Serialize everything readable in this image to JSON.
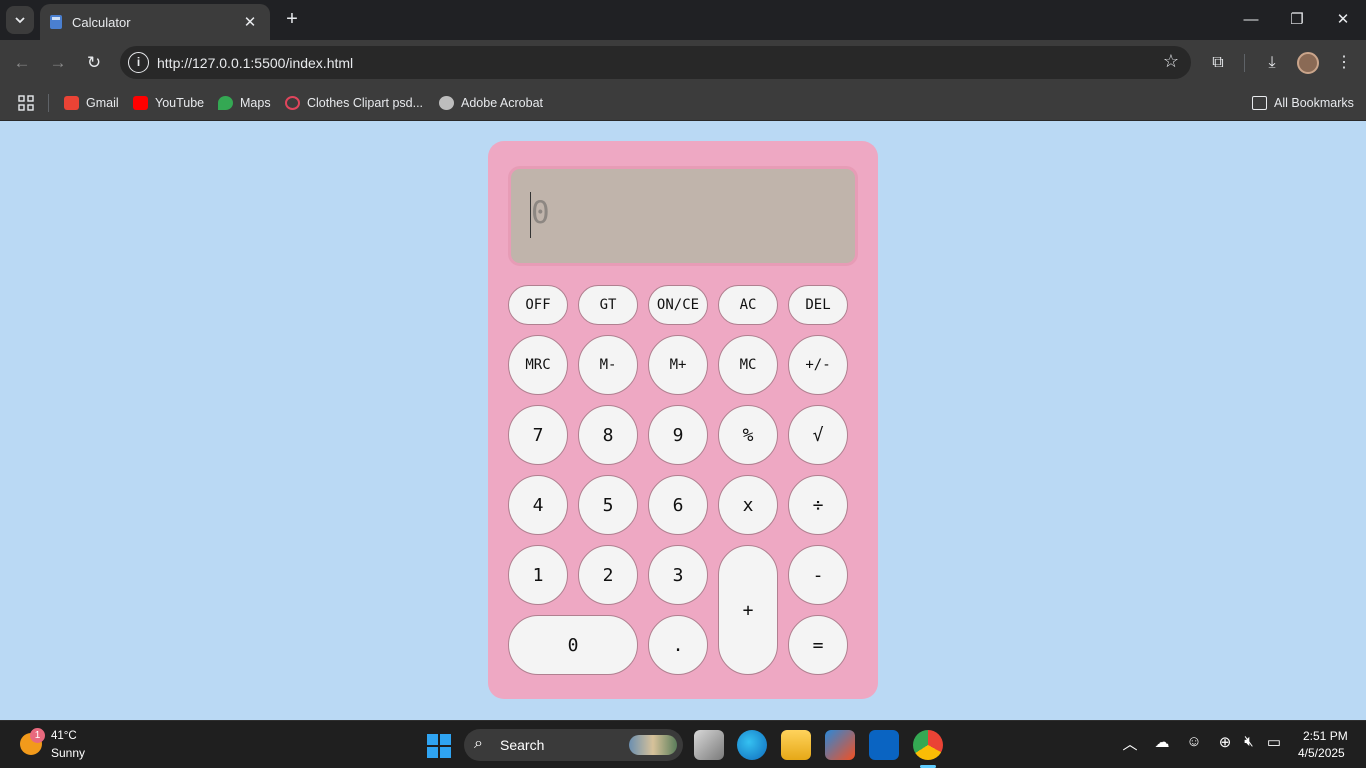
{
  "browser": {
    "tab_title": "Calculator",
    "url": "http://127.0.0.1:5500/index.html",
    "bookmarks": [
      {
        "label": "Gmail",
        "icon": "gmail-icon",
        "color": "#ea4335"
      },
      {
        "label": "YouTube",
        "icon": "youtube-icon",
        "color": "#ff0000"
      },
      {
        "label": "Maps",
        "icon": "maps-icon",
        "color": "#34a853"
      },
      {
        "label": "Clothes Clipart psd...",
        "icon": "clothes-clipart-icon",
        "color": "#e0455c"
      },
      {
        "label": "Adobe Acrobat",
        "icon": "acrobat-icon",
        "color": "#bdbdbd"
      }
    ],
    "all_bookmarks": "All Bookmarks"
  },
  "calculator": {
    "display": "0",
    "keys": {
      "off": "OFF",
      "gt": "GT",
      "on_ce": "ON/CE",
      "ac": "AC",
      "del": "DEL",
      "mrc": "MRC",
      "m_minus": "M-",
      "m_plus": "M+",
      "mc": "MC",
      "plus_minus": "+/-",
      "seven": "7",
      "eight": "8",
      "nine": "9",
      "percent": "%",
      "sqrt": "√",
      "four": "4",
      "five": "5",
      "six": "6",
      "multiply": "x",
      "divide": "÷",
      "one": "1",
      "two": "2",
      "three": "3",
      "plus": "+",
      "minus": "-",
      "zero": "0",
      "dot": ".",
      "equals": "="
    },
    "colors": {
      "body": "#eea8c3",
      "screen": "#c0b4ab",
      "page_bg": "#bad9f4"
    }
  },
  "taskbar": {
    "weather_badge": "1",
    "temperature": "41°C",
    "condition": "Sunny",
    "search_label": "Search",
    "time": "2:51 PM",
    "date": "4/5/2025"
  }
}
